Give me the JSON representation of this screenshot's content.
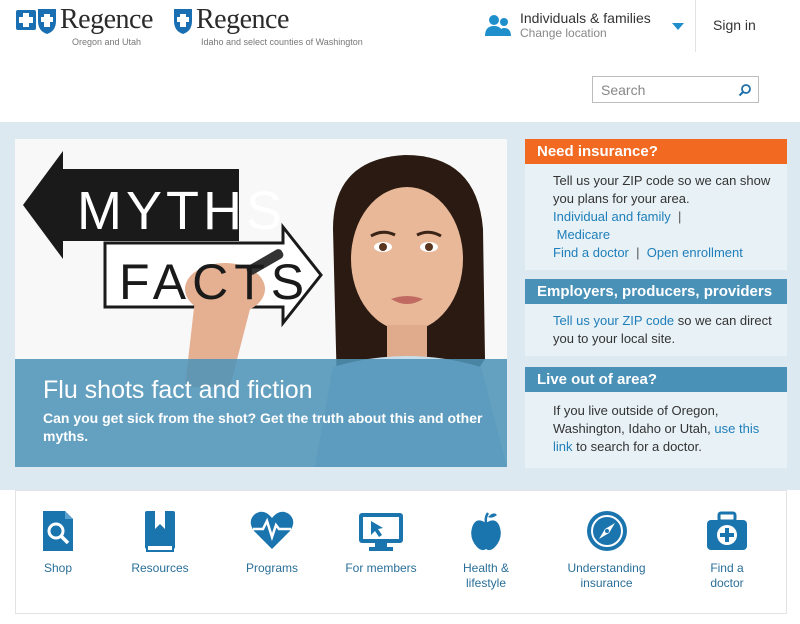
{
  "header": {
    "brands": [
      {
        "name": "Regence",
        "region": "Oregon and Utah"
      },
      {
        "name": "Regence",
        "region": "Idaho and select counties of Washington"
      }
    ],
    "audience": {
      "title": "Individuals & families",
      "subtitle": "Change location"
    },
    "signin_label": "Sign in",
    "search": {
      "placeholder": "Search",
      "value": ""
    }
  },
  "hero": {
    "image_text": {
      "myths": "MYTHS",
      "facts": "FACTS"
    },
    "title": "Flu shots fact and fiction",
    "text": "Can you get sick from the shot? Get the truth about this and other myths."
  },
  "panels": {
    "insurance": {
      "title": "Need insurance?",
      "text": "Tell us your ZIP code so we can show you plans for your area.",
      "link_individual": "Individual and family",
      "link_medicare": "Medicare",
      "link_doctor": "Find a doctor",
      "link_enrollment": "Open enrollment",
      "separator": "|"
    },
    "employers": {
      "title": "Employers, producers, providers",
      "link": "Tell us your ZIP code",
      "text": "so we can direct you to your local site."
    },
    "outofarea": {
      "title": "Live out of area?",
      "text_before": "If you live outside of Oregon, Washington, Idaho or Utah,",
      "link": "use this link",
      "text_after": "to search for a doctor."
    }
  },
  "nav": [
    {
      "label": "Shop",
      "icon": "shop-icon"
    },
    {
      "label": "Resources",
      "icon": "bookmark-book-icon"
    },
    {
      "label": "Programs",
      "icon": "heart-pulse-icon"
    },
    {
      "label": "For members",
      "icon": "monitor-cursor-icon"
    },
    {
      "label": "Health & lifestyle",
      "icon": "apple-icon"
    },
    {
      "label": "Understanding insurance",
      "icon": "compass-icon"
    },
    {
      "label": "Find a doctor",
      "icon": "medical-kit-icon"
    }
  ],
  "colors": {
    "accent_blue": "#1f8fcc",
    "orange": "#f26a21",
    "teal": "#4a91b8",
    "band": "#dce9f1"
  }
}
